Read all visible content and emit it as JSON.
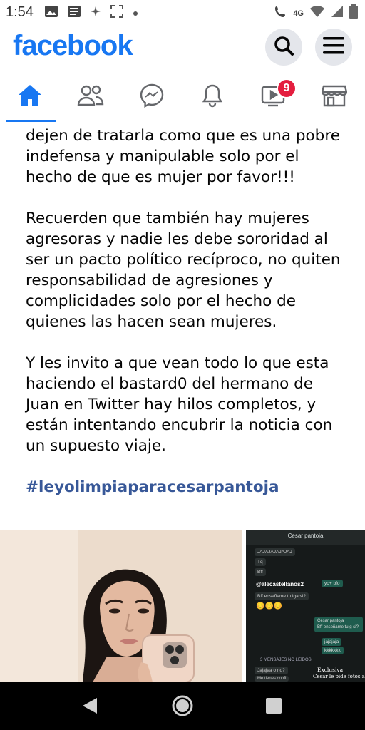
{
  "status_bar": {
    "time": "1:54",
    "network": "4G",
    "icons": [
      "image-icon",
      "news-icon",
      "sparkle-icon",
      "screenshot-icon",
      "dot-icon",
      "call-icon",
      "wifi-icon",
      "signal-icon",
      "battery-icon"
    ]
  },
  "header": {
    "logo": "facebook",
    "search_icon": "search-icon",
    "menu_icon": "menu-icon"
  },
  "nav": {
    "items": [
      {
        "name": "home",
        "icon": "home-icon",
        "active": true
      },
      {
        "name": "friends",
        "icon": "friends-icon"
      },
      {
        "name": "messenger",
        "icon": "messenger-icon"
      },
      {
        "name": "notifications",
        "icon": "bell-icon"
      },
      {
        "name": "watch",
        "icon": "video-icon",
        "badge": "9"
      },
      {
        "name": "marketplace",
        "icon": "store-icon"
      }
    ]
  },
  "post": {
    "partial_top": "poder agredir y encubrir agresiones, dejen de tratarla como que es una pobre indefensa y manipulable solo por el hecho de que es mujer por favor!!!",
    "paragraph_2": "Recuerden que también hay mujeres agresoras y nadie les debe sororidad al ser un pacto político recíproco, no quiten responsabilidad de agresiones y complicidades solo por el hecho de quienes las hacen sean mujeres.",
    "paragraph_3": "Y les invito a que vean todo lo que esta haciendo el bastard0 del hermano de Juan en Twitter hay hilos completos, y están intentando encubrir la noticia con un supuesto viaje.",
    "hashtag": "#leyolimpiaparacesarpantoja"
  },
  "images": {
    "right_chat": {
      "title": "Cesar pantoja",
      "watermark": "@alecastellanos2",
      "messages": [
        "JAJAJAJAJAJAJ",
        "Tq",
        "Bff",
        "yo+ bfo",
        "Bff enseñame tu lga si?",
        "😊😊😊",
        "Cesar pantoja",
        "Bff enseñame tu g si?",
        "jajajaja",
        "kkkkkkk",
        "3 MENSAJES NO LEÍDOS",
        "Jajajaa o no?",
        "Me tienes confi"
      ],
      "caption_1": "Exclusiva",
      "caption_2": "Cesar le pide fotos a"
    }
  },
  "android_nav": {
    "back": "back-icon",
    "home": "home-circle-icon",
    "recents": "recents-icon"
  }
}
